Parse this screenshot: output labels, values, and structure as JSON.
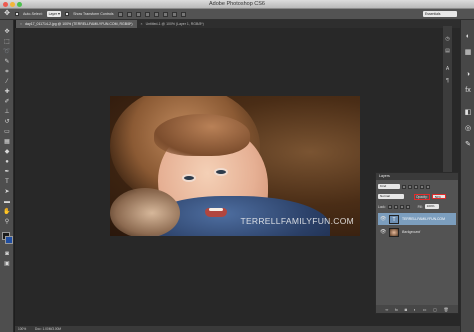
{
  "app": {
    "title": "Adobe Photoshop CS6"
  },
  "options_bar": {
    "auto_select_label": "Auto-Select:",
    "auto_select_value": "Layer",
    "show_transform_label": "Show Transform Controls",
    "workspace": "Essentials"
  },
  "tabs": [
    {
      "label": "day17_011714-2.jpg @ 100% (TERRELLFAMILYFUN.COM, RGB/8*)"
    },
    {
      "label": "Untitled-1 @ 100% (Layer 1, RGB/8*)"
    }
  ],
  "photo": {
    "watermark": "TERRELLFAMILYFUN.COM"
  },
  "layers_panel": {
    "title": "Layers",
    "kind_label": "Kind",
    "blend_mode": "Normal",
    "opacity_label": "Opacity:",
    "opacity_value": "50%",
    "lock_label": "Lock:",
    "fill_label": "Fill:",
    "fill_value": "100%",
    "layers": [
      {
        "name": "TERRELLFAMILYFUN.COM",
        "selected": true
      },
      {
        "name": "Background",
        "selected": false
      }
    ],
    "footer_icons": [
      "link-icon",
      "fx-icon",
      "mask-icon",
      "adjustment-icon",
      "folder-icon",
      "new-layer-icon",
      "trash-icon"
    ]
  },
  "status": {
    "zoom": "100%",
    "doc": "Doc: 1.00M/3.00M"
  },
  "colors": {
    "foreground": "#1b1b1b",
    "background": "#1f4da0",
    "highlight": "#e22a2a"
  }
}
